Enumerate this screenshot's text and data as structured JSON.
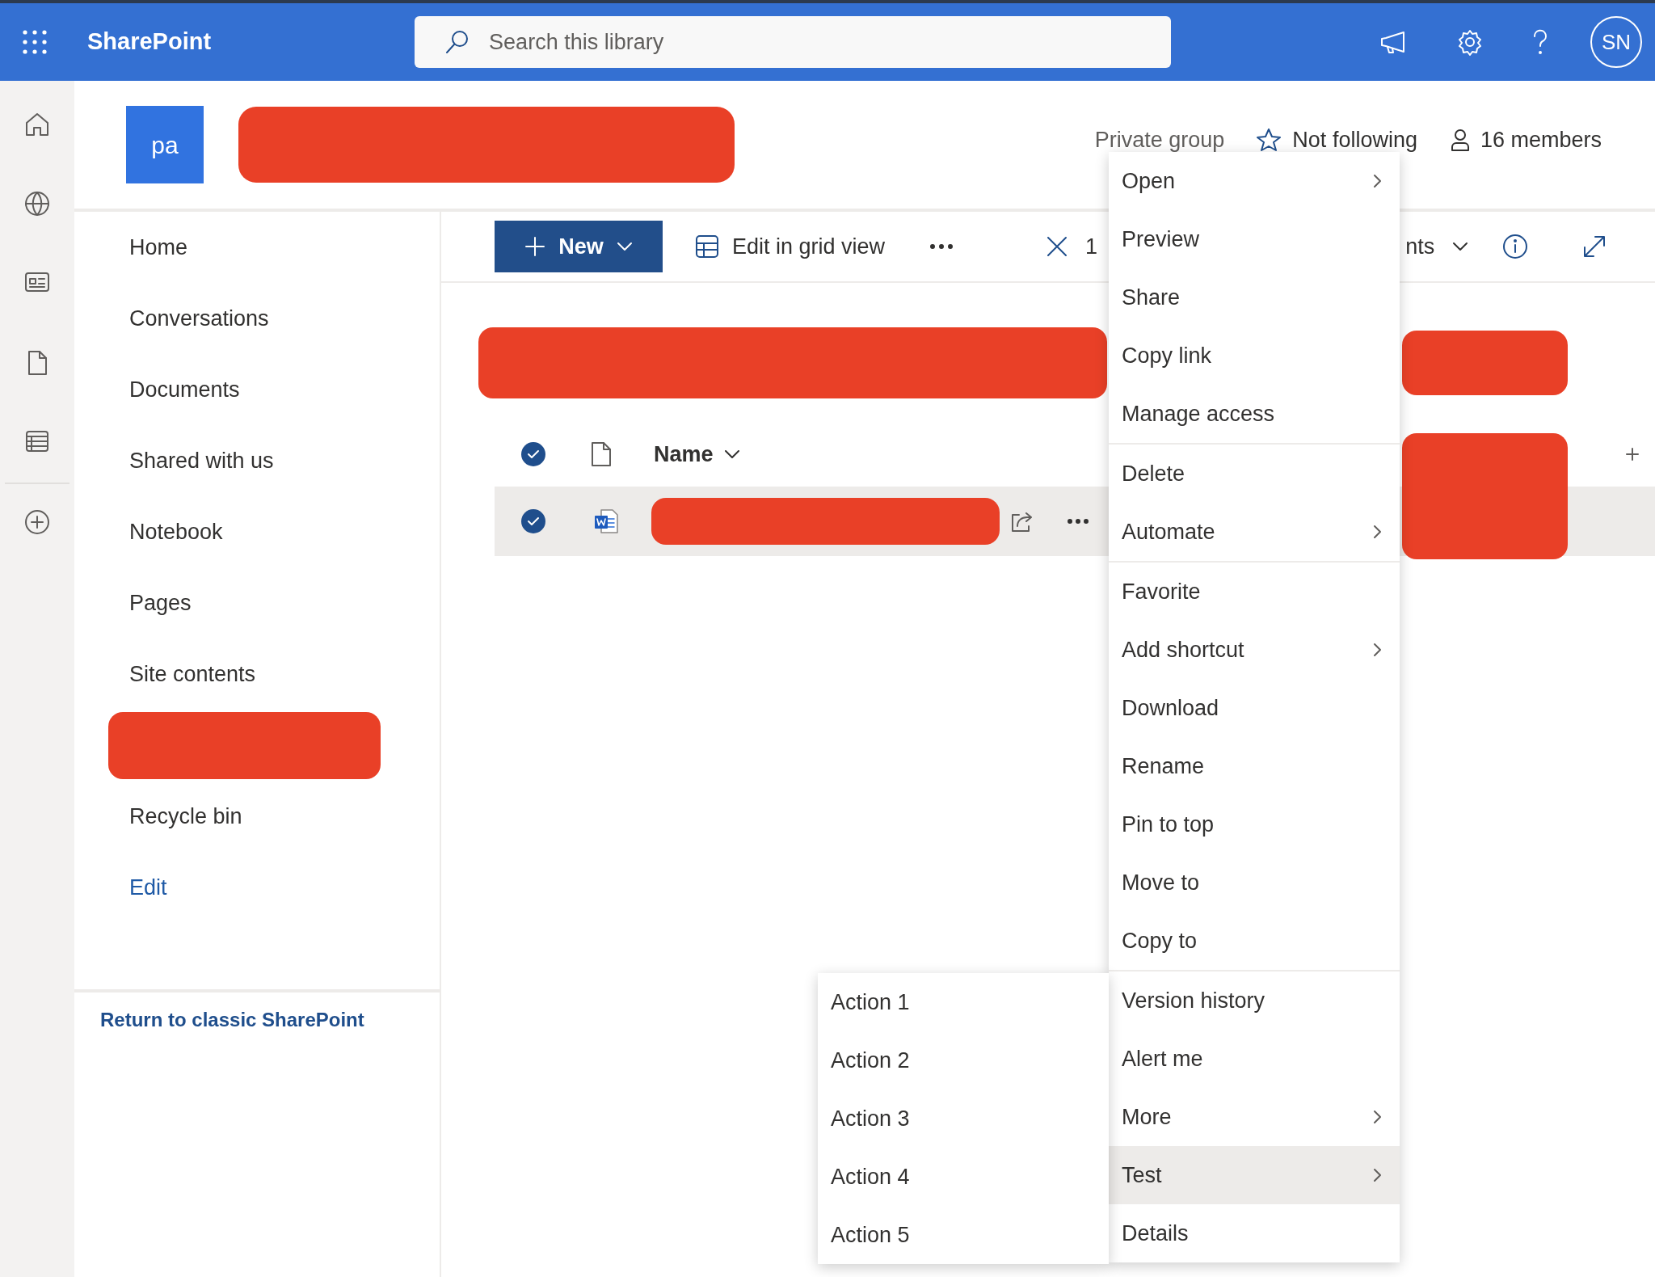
{
  "top_bar": {
    "app_name": "SharePoint",
    "search": {
      "placeholder": "Search this library"
    },
    "avatar": "SN"
  },
  "site_header": {
    "logo_text": "pa",
    "privacy": "Private group",
    "follow": {
      "label": "Not following",
      "following": false
    },
    "members": "16 members"
  },
  "nav": {
    "items": [
      {
        "kind": "link",
        "label": "Home"
      },
      {
        "kind": "link",
        "label": "Conversations"
      },
      {
        "kind": "link",
        "label": "Documents"
      },
      {
        "kind": "link",
        "label": "Shared with us"
      },
      {
        "kind": "link",
        "label": "Notebook"
      },
      {
        "kind": "link",
        "label": "Pages"
      },
      {
        "kind": "link",
        "label": "Site contents"
      },
      {
        "kind": "redacted"
      },
      {
        "kind": "link",
        "label": "Recycle bin"
      },
      {
        "kind": "edit",
        "label": "Edit"
      }
    ],
    "classic_link": "Return to classic SharePoint"
  },
  "command_bar": {
    "new_button": "New",
    "grid_view": "Edit in grid view",
    "selection_count": "1",
    "view_fragment": "nts"
  },
  "list": {
    "header": {
      "all_selected": true,
      "name_column": "Name"
    },
    "rows": [
      {
        "selected": true,
        "kind": "word"
      }
    ]
  },
  "context_menu": {
    "groups": [
      {
        "items": [
          {
            "label": "Open",
            "has_submenu": true,
            "expanded": false
          },
          {
            "label": "Preview",
            "has_submenu": false,
            "expanded": false
          },
          {
            "label": "Share",
            "has_submenu": false,
            "expanded": false
          },
          {
            "label": "Copy link",
            "has_submenu": false,
            "expanded": false
          },
          {
            "label": "Manage access",
            "has_submenu": false,
            "expanded": false
          }
        ]
      },
      {
        "items": [
          {
            "label": "Delete",
            "has_submenu": false,
            "expanded": false
          },
          {
            "label": "Automate",
            "has_submenu": true,
            "expanded": false
          }
        ]
      },
      {
        "items": [
          {
            "label": "Favorite",
            "has_submenu": false,
            "expanded": false
          },
          {
            "label": "Add shortcut",
            "has_submenu": true,
            "expanded": false
          },
          {
            "label": "Download",
            "has_submenu": false,
            "expanded": false
          },
          {
            "label": "Rename",
            "has_submenu": false,
            "expanded": false
          },
          {
            "label": "Pin to top",
            "has_submenu": false,
            "expanded": false
          },
          {
            "label": "Move to",
            "has_submenu": false,
            "expanded": false
          },
          {
            "label": "Copy to",
            "has_submenu": false,
            "expanded": false
          }
        ]
      },
      {
        "items": [
          {
            "label": "Version history",
            "has_submenu": false,
            "expanded": false
          },
          {
            "label": "Alert me",
            "has_submenu": false,
            "expanded": false
          },
          {
            "label": "More",
            "has_submenu": true,
            "expanded": false
          },
          {
            "label": "Test",
            "has_submenu": true,
            "expanded": true
          },
          {
            "label": "Details",
            "has_submenu": false,
            "expanded": false
          }
        ]
      }
    ]
  },
  "submenu": {
    "items": [
      "Action 1",
      "Action 2",
      "Action 3",
      "Action 4",
      "Action 5"
    ]
  }
}
